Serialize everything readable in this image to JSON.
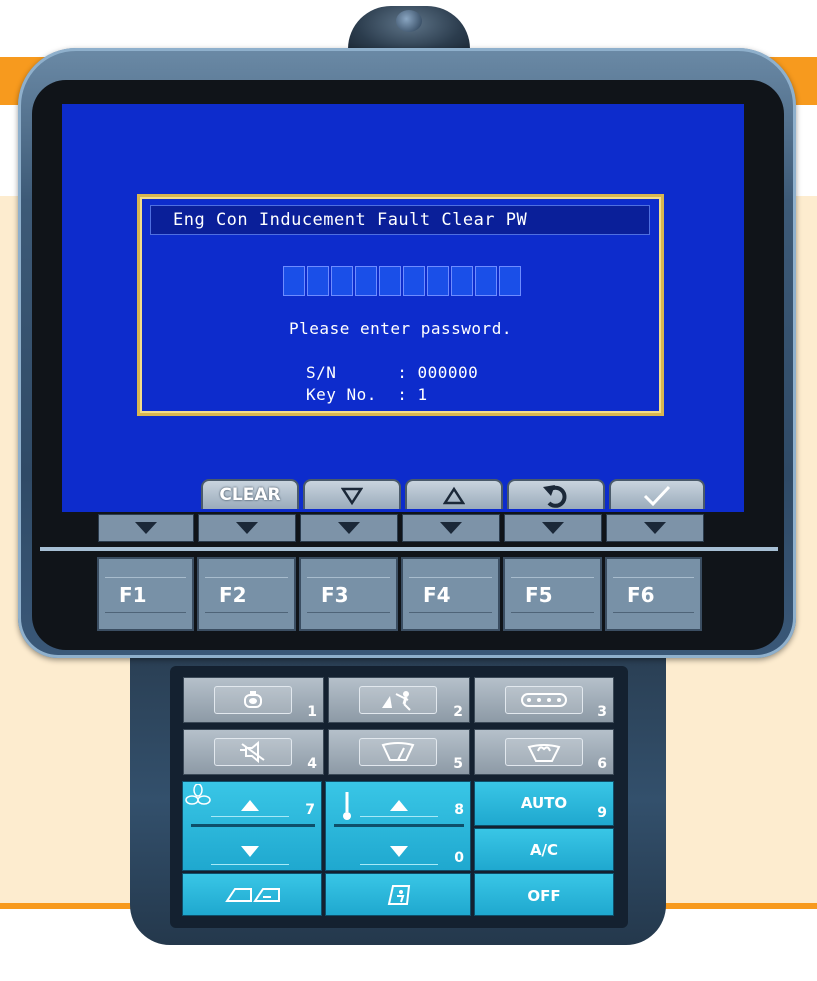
{
  "dialog": {
    "title": "Eng Con Inducement Fault Clear PW",
    "password_slots": 10,
    "prompt": "Please enter password.",
    "sn_label": "S/N      : ",
    "sn_value": "000000",
    "key_label": "Key No.  : ",
    "key_value": "1"
  },
  "softkeys": {
    "clear_label": "CLEAR",
    "down_icon": "triangle-down-outline-icon",
    "up_icon": "triangle-up-outline-icon",
    "back_icon": "return-arrow-icon",
    "confirm_icon": "checkmark-icon"
  },
  "function_keys": [
    "F1",
    "F2",
    "F3",
    "F4",
    "F5",
    "F6"
  ],
  "keypad": {
    "row1": [
      {
        "icon": "engine-icon",
        "number": "1"
      },
      {
        "icon": "work-mode-icon",
        "number": "2"
      },
      {
        "icon": "travel-speed-icon",
        "number": "3"
      }
    ],
    "row2": [
      {
        "icon": "buzzer-cancel-icon",
        "number": "4"
      },
      {
        "icon": "wiper-icon",
        "number": "5"
      },
      {
        "icon": "washer-icon",
        "number": "6"
      }
    ],
    "fan_up_number": "7",
    "temp_up_number": "8",
    "temp_down_number": "0",
    "auto_label": "AUTO",
    "auto_number": "9",
    "ac_label": "A/C",
    "off_label": "OFF"
  },
  "colors": {
    "screen_blue": "#0d2ccc",
    "dialog_border": "#d8b650",
    "accent_orange": "#f79a1e",
    "keypad_cyan": "#2bb7dc"
  }
}
